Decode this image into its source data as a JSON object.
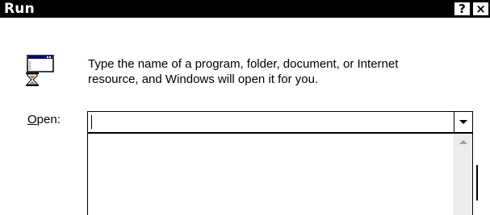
{
  "window": {
    "title": "Run",
    "help_label": "?",
    "close_label": "×"
  },
  "icons": {
    "app": "run-program-icon",
    "dropdown": "chevron-down-icon",
    "scroll_up": "scroll-up-arrow-icon"
  },
  "prompt": {
    "line1": "Type the name of a program, folder, document, or Internet",
    "line2": "resource, and Windows will open it for you."
  },
  "open_field": {
    "label_accel": "O",
    "label_rest": "pen:",
    "value": "",
    "placeholder": ""
  },
  "dropdown": {
    "items": []
  }
}
